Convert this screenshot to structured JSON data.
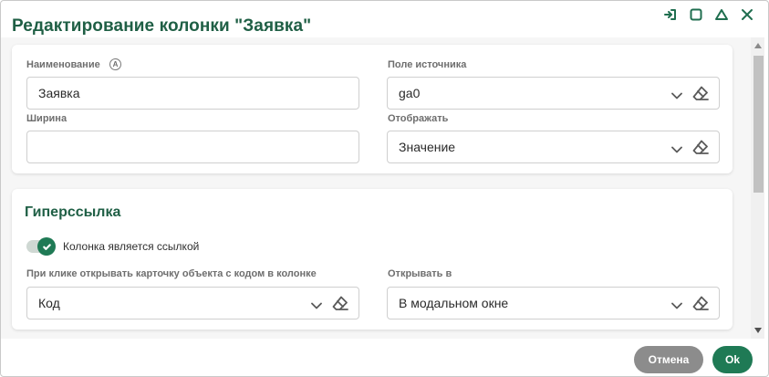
{
  "dialog": {
    "title": "Редактирование колонки \"Заявка\""
  },
  "window_controls": [
    "sign-out-icon",
    "maximize-icon",
    "collapse-icon",
    "close-icon"
  ],
  "general": {
    "name_label": "Наименование",
    "name_badge": "A",
    "name_value": "Заявка",
    "source_label": "Поле источника",
    "source_value": "ga0",
    "width_label": "Ширина",
    "width_value": "",
    "display_label": "Отображать",
    "display_value": "Значение"
  },
  "hyperlink": {
    "section_title": "Гиперссылка",
    "toggle_label": "Колонка является ссылкой",
    "toggle_on": true,
    "open_card_label": "При клике открывать карточку объекта с кодом в колонке",
    "open_card_value": "Код",
    "open_in_label": "Открывать в",
    "open_in_value": "В модальном окне"
  },
  "footer": {
    "cancel_label": "Отмена",
    "ok_label": "Ok"
  },
  "colors": {
    "accent": "#1f7a55",
    "title": "#1f5f45",
    "cancel": "#8c8c8c"
  }
}
